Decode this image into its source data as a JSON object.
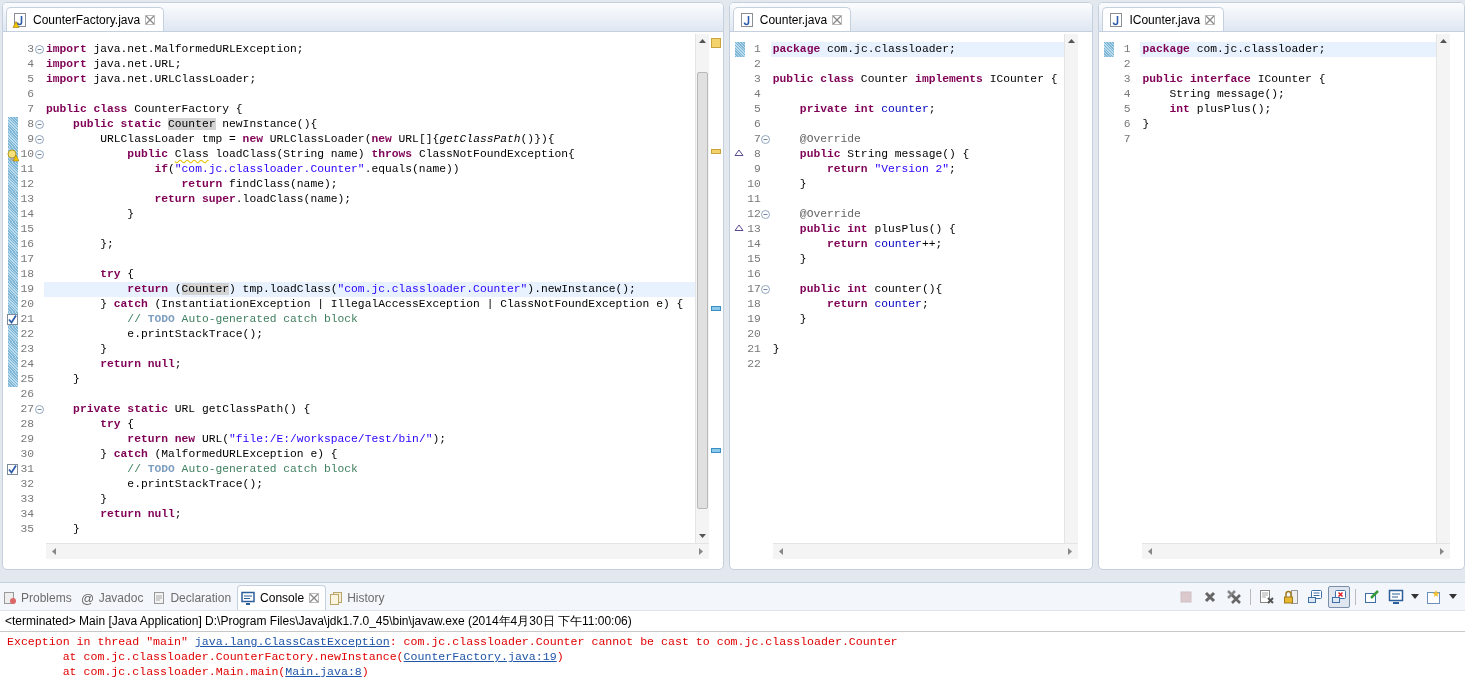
{
  "editors": [
    {
      "tab": {
        "label": "CounterFactory.java",
        "selected": true,
        "warning": true
      },
      "lines": [
        {
          "number": "3",
          "kind": "plain",
          "changed": false,
          "folding": true,
          "current": false,
          "tokens": [
            {
              "kind": "kw",
              "text": "import"
            },
            {
              "kind": "plain",
              "text": " java.net.MalformedURLException;"
            }
          ]
        },
        {
          "number": "4",
          "kind": "plain",
          "changed": false,
          "folding": false,
          "current": false,
          "tokens": [
            {
              "kind": "kw",
              "text": "import"
            },
            {
              "kind": "plain",
              "text": " java.net.URL;"
            }
          ]
        },
        {
          "number": "5",
          "kind": "plain",
          "changed": false,
          "folding": false,
          "current": false,
          "tokens": [
            {
              "kind": "kw",
              "text": "import"
            },
            {
              "kind": "plain",
              "text": " java.net.URLClassLoader;"
            }
          ]
        },
        {
          "number": "6",
          "kind": "plain",
          "changed": false,
          "folding": false,
          "current": false
        },
        {
          "number": "7",
          "kind": "plain",
          "changed": false,
          "folding": false,
          "current": false,
          "tokens": [
            {
              "kind": "kw",
              "text": "public class"
            },
            {
              "kind": "plain",
              "text": " CounterFactory {"
            }
          ]
        },
        {
          "number": "8",
          "kind": "plain",
          "changed": true,
          "folding": true,
          "current": false,
          "tokens": [
            {
              "kind": "kw",
              "text": "    public static "
            },
            {
              "kind": "occurrence",
              "text": "Counter"
            },
            {
              "kind": "plain",
              "text": " newInstance(){"
            }
          ]
        },
        {
          "number": "9",
          "kind": "plain",
          "changed": true,
          "folding": true,
          "current": false,
          "tokens": [
            {
              "kind": "plain",
              "text": "        URLClassLoader tmp = "
            },
            {
              "kind": "kw",
              "text": "new"
            },
            {
              "kind": "plain",
              "text": " URLClassLoader("
            },
            {
              "kind": "kw",
              "text": "new"
            },
            {
              "kind": "plain",
              "text": " URL[]{"
            },
            {
              "kind": "italic",
              "text": "getClassPath"
            },
            {
              "kind": "plain",
              "text": "()}){"
            }
          ]
        },
        {
          "number": "10",
          "kind": "warning",
          "changed": true,
          "folding": true,
          "current": false,
          "tokens": [
            {
              "kind": "kw",
              "text": "            public "
            },
            {
              "kind": "warn",
              "text": "Class"
            },
            {
              "kind": "plain",
              "text": " loadClass(String name) "
            },
            {
              "kind": "kw",
              "text": "throws"
            },
            {
              "kind": "plain",
              "text": " ClassNotFoundException{"
            }
          ]
        },
        {
          "number": "11",
          "kind": "plain",
          "changed": true,
          "folding": false,
          "current": false,
          "tokens": [
            {
              "kind": "kw",
              "text": "                if"
            },
            {
              "kind": "plain",
              "text": "("
            },
            {
              "kind": "string",
              "text": "\"com.jc.classloader.Counter\""
            },
            {
              "kind": "plain",
              "text": ".equals(name))"
            }
          ]
        },
        {
          "number": "12",
          "kind": "plain",
          "changed": true,
          "folding": false,
          "current": false,
          "tokens": [
            {
              "kind": "kw",
              "text": "                    return"
            },
            {
              "kind": "plain",
              "text": " findClass(name);"
            }
          ]
        },
        {
          "number": "13",
          "kind": "plain",
          "changed": true,
          "folding": false,
          "current": false,
          "tokens": [
            {
              "kind": "kw",
              "text": "                return super"
            },
            {
              "kind": "plain",
              "text": ".loadClass(name);"
            }
          ]
        },
        {
          "number": "14",
          "kind": "plain",
          "changed": true,
          "folding": false,
          "current": false,
          "tokens": [
            {
              "kind": "plain",
              "text": "            }"
            }
          ]
        },
        {
          "number": "15",
          "kind": "plain",
          "changed": true,
          "folding": false,
          "current": false
        },
        {
          "number": "16",
          "kind": "plain",
          "changed": true,
          "folding": false,
          "current": false,
          "tokens": [
            {
              "kind": "plain",
              "text": "        };"
            }
          ]
        },
        {
          "number": "17",
          "kind": "plain",
          "changed": true,
          "folding": false,
          "current": false
        },
        {
          "number": "18",
          "kind": "plain",
          "changed": true,
          "folding": false,
          "current": false,
          "tokens": [
            {
              "kind": "kw",
              "text": "        try"
            },
            {
              "kind": "plain",
              "text": " {"
            }
          ]
        },
        {
          "number": "19",
          "kind": "plain",
          "changed": true,
          "folding": false,
          "current": true,
          "tokens": [
            {
              "kind": "kw",
              "text": "            return"
            },
            {
              "kind": "plain",
              "text": " ("
            },
            {
              "kind": "occurrence",
              "text": "Counter"
            },
            {
              "kind": "plain",
              "text": ") tmp.loadClass("
            },
            {
              "kind": "string",
              "text": "\"com.jc.classloader.Counter\""
            },
            {
              "kind": "plain",
              "text": ").newInstance();"
            }
          ]
        },
        {
          "number": "20",
          "kind": "plain",
          "changed": true,
          "folding": false,
          "current": false,
          "tokens": [
            {
              "kind": "plain",
              "text": "        } "
            },
            {
              "kind": "kw",
              "text": "catch"
            },
            {
              "kind": "plain",
              "text": " (InstantiationException | IllegalAccessException | ClassNotFoundException e) {"
            }
          ]
        },
        {
          "number": "21",
          "kind": "task",
          "changed": true,
          "folding": false,
          "current": false,
          "tokens": [
            {
              "kind": "comment",
              "text": "            // "
            },
            {
              "kind": "todo",
              "text": "TODO"
            },
            {
              "kind": "comment",
              "text": " Auto-generated catch block"
            }
          ]
        },
        {
          "number": "22",
          "kind": "plain",
          "changed": true,
          "folding": false,
          "current": false,
          "tokens": [
            {
              "kind": "plain",
              "text": "            e.printStackTrace();"
            }
          ]
        },
        {
          "number": "23",
          "kind": "plain",
          "changed": true,
          "folding": false,
          "current": false,
          "tokens": [
            {
              "kind": "plain",
              "text": "        }"
            }
          ]
        },
        {
          "number": "24",
          "kind": "plain",
          "changed": true,
          "folding": false,
          "current": false,
          "tokens": [
            {
              "kind": "kw",
              "text": "        return null"
            },
            {
              "kind": "plain",
              "text": ";"
            }
          ]
        },
        {
          "number": "25",
          "kind": "plain",
          "changed": true,
          "folding": false,
          "current": false,
          "tokens": [
            {
              "kind": "plain",
              "text": "    }"
            }
          ]
        },
        {
          "number": "26",
          "kind": "plain",
          "changed": false,
          "folding": false,
          "current": false
        },
        {
          "number": "27",
          "kind": "plain",
          "changed": false,
          "folding": true,
          "current": false,
          "tokens": [
            {
              "kind": "kw",
              "text": "    private static"
            },
            {
              "kind": "plain",
              "text": " URL getClassPath() {"
            }
          ]
        },
        {
          "number": "28",
          "kind": "plain",
          "changed": false,
          "folding": false,
          "current": false,
          "tokens": [
            {
              "kind": "kw",
              "text": "        try"
            },
            {
              "kind": "plain",
              "text": " {"
            }
          ]
        },
        {
          "number": "29",
          "kind": "plain",
          "changed": false,
          "folding": false,
          "current": false,
          "tokens": [
            {
              "kind": "kw",
              "text": "            return new"
            },
            {
              "kind": "plain",
              "text": " URL("
            },
            {
              "kind": "string",
              "text": "\"file:/E:/workspace/Test/bin/\""
            },
            {
              "kind": "plain",
              "text": ");"
            }
          ]
        },
        {
          "number": "30",
          "kind": "plain",
          "changed": false,
          "folding": false,
          "current": false,
          "tokens": [
            {
              "kind": "plain",
              "text": "        } "
            },
            {
              "kind": "kw",
              "text": "catch"
            },
            {
              "kind": "plain",
              "text": " (MalformedURLException e) {"
            }
          ]
        },
        {
          "number": "31",
          "kind": "task",
          "changed": false,
          "folding": false,
          "current": false,
          "tokens": [
            {
              "kind": "comment",
              "text": "            // "
            },
            {
              "kind": "todo",
              "text": "TODO"
            },
            {
              "kind": "comment",
              "text": " Auto-generated catch block"
            }
          ]
        },
        {
          "number": "32",
          "kind": "plain",
          "changed": false,
          "folding": false,
          "current": false,
          "tokens": [
            {
              "kind": "plain",
              "text": "            e.printStackTrace();"
            }
          ]
        },
        {
          "number": "33",
          "kind": "plain",
          "changed": false,
          "folding": false,
          "current": false,
          "tokens": [
            {
              "kind": "plain",
              "text": "        }"
            }
          ]
        },
        {
          "number": "34",
          "kind": "plain",
          "changed": false,
          "folding": false,
          "current": false,
          "tokens": [
            {
              "kind": "kw",
              "text": "        return null"
            },
            {
              "kind": "plain",
              "text": ";"
            }
          ]
        },
        {
          "number": "35",
          "kind": "plain",
          "changed": false,
          "folding": false,
          "current": false,
          "tokens": [
            {
              "kind": "plain",
              "text": "    }"
            }
          ]
        }
      ]
    },
    {
      "tab": {
        "label": "Counter.java",
        "selected": true,
        "warning": false
      },
      "lines": [
        {
          "number": "1",
          "kind": "plain",
          "changed": true,
          "folding": false,
          "current": true,
          "tokens": [
            {
              "kind": "kw",
              "text": "package"
            },
            {
              "kind": "plain",
              "text": " com.jc.classloader;"
            }
          ]
        },
        {
          "number": "2",
          "kind": "plain",
          "changed": false,
          "folding": false,
          "current": false
        },
        {
          "number": "3",
          "kind": "plain",
          "changed": false,
          "folding": false,
          "current": false,
          "tokens": [
            {
              "kind": "kw",
              "text": "public class"
            },
            {
              "kind": "plain",
              "text": " Counter "
            },
            {
              "kind": "kw",
              "text": "implements"
            },
            {
              "kind": "plain",
              "text": " ICounter {"
            }
          ]
        },
        {
          "number": "4",
          "kind": "plain",
          "changed": false,
          "folding": false,
          "current": false
        },
        {
          "number": "5",
          "kind": "plain",
          "changed": false,
          "folding": false,
          "current": false,
          "tokens": [
            {
              "kind": "kw",
              "text": "    private int "
            },
            {
              "kind": "field",
              "text": "counter"
            },
            {
              "kind": "plain",
              "text": ";"
            }
          ]
        },
        {
          "number": "6",
          "kind": "plain",
          "changed": false,
          "folding": false,
          "current": false
        },
        {
          "number": "7",
          "kind": "plain",
          "changed": false,
          "folding": true,
          "current": false,
          "tokens": [
            {
              "kind": "annotation",
              "text": "    @Override"
            }
          ]
        },
        {
          "number": "8",
          "kind": "override",
          "changed": false,
          "folding": false,
          "current": false,
          "tokens": [
            {
              "kind": "kw",
              "text": "    public"
            },
            {
              "kind": "plain",
              "text": " String message() {"
            }
          ]
        },
        {
          "number": "9",
          "kind": "plain",
          "changed": false,
          "folding": false,
          "current": false,
          "tokens": [
            {
              "kind": "kw",
              "text": "        return "
            },
            {
              "kind": "string",
              "text": "\"Version 2\""
            },
            {
              "kind": "plain",
              "text": ";"
            }
          ]
        },
        {
          "number": "10",
          "kind": "plain",
          "changed": false,
          "folding": false,
          "current": false,
          "tokens": [
            {
              "kind": "plain",
              "text": "    }"
            }
          ]
        },
        {
          "number": "11",
          "kind": "plain",
          "changed": false,
          "folding": false,
          "current": false
        },
        {
          "number": "12",
          "kind": "plain",
          "changed": false,
          "folding": true,
          "current": false,
          "tokens": [
            {
              "kind": "annotation",
              "text": "    @Override"
            }
          ]
        },
        {
          "number": "13",
          "kind": "override",
          "changed": false,
          "folding": false,
          "current": false,
          "tokens": [
            {
              "kind": "kw",
              "text": "    public int"
            },
            {
              "kind": "plain",
              "text": " plusPlus() {"
            }
          ]
        },
        {
          "number": "14",
          "kind": "plain",
          "changed": false,
          "folding": false,
          "current": false,
          "tokens": [
            {
              "kind": "kw",
              "text": "        return "
            },
            {
              "kind": "field",
              "text": "counter"
            },
            {
              "kind": "plain",
              "text": "++;"
            }
          ]
        },
        {
          "number": "15",
          "kind": "plain",
          "changed": false,
          "folding": false,
          "current": false,
          "tokens": [
            {
              "kind": "plain",
              "text": "    }"
            }
          ]
        },
        {
          "number": "16",
          "kind": "plain",
          "changed": false,
          "folding": false,
          "current": false
        },
        {
          "number": "17",
          "kind": "plain",
          "changed": false,
          "folding": true,
          "current": false,
          "tokens": [
            {
              "kind": "kw",
              "text": "    public int"
            },
            {
              "kind": "plain",
              "text": " counter(){"
            }
          ]
        },
        {
          "number": "18",
          "kind": "plain",
          "changed": false,
          "folding": false,
          "current": false,
          "tokens": [
            {
              "kind": "kw",
              "text": "        return "
            },
            {
              "kind": "field",
              "text": "counter"
            },
            {
              "kind": "plain",
              "text": ";"
            }
          ]
        },
        {
          "number": "19",
          "kind": "plain",
          "changed": false,
          "folding": false,
          "current": false,
          "tokens": [
            {
              "kind": "plain",
              "text": "    }"
            }
          ]
        },
        {
          "number": "20",
          "kind": "plain",
          "changed": false,
          "folding": false,
          "current": false
        },
        {
          "number": "21",
          "kind": "plain",
          "changed": false,
          "folding": false,
          "current": false,
          "tokens": [
            {
              "kind": "plain",
              "text": "}"
            }
          ]
        },
        {
          "number": "22",
          "kind": "plain",
          "changed": false,
          "folding": false,
          "current": false
        }
      ]
    },
    {
      "tab": {
        "label": "ICounter.java",
        "selected": true,
        "warning": false
      },
      "lines": [
        {
          "number": "1",
          "kind": "plain",
          "changed": true,
          "folding": false,
          "current": true,
          "tokens": [
            {
              "kind": "kw",
              "text": "package"
            },
            {
              "kind": "plain",
              "text": " com.jc.classloader;"
            }
          ]
        },
        {
          "number": "2",
          "kind": "plain",
          "changed": false,
          "folding": false,
          "current": false
        },
        {
          "number": "3",
          "kind": "plain",
          "changed": false,
          "folding": false,
          "current": false,
          "tokens": [
            {
              "kind": "kw",
              "text": "public interface"
            },
            {
              "kind": "plain",
              "text": " ICounter {"
            }
          ]
        },
        {
          "number": "4",
          "kind": "plain",
          "changed": false,
          "folding": false,
          "current": false,
          "tokens": [
            {
              "kind": "plain",
              "text": "    String message();"
            }
          ]
        },
        {
          "number": "5",
          "kind": "plain",
          "changed": false,
          "folding": false,
          "current": false,
          "tokens": [
            {
              "kind": "kw",
              "text": "    int"
            },
            {
              "kind": "plain",
              "text": " plusPlus();"
            }
          ]
        },
        {
          "number": "6",
          "kind": "plain",
          "changed": false,
          "folding": false,
          "current": false,
          "tokens": [
            {
              "kind": "plain",
              "text": "}"
            }
          ]
        },
        {
          "number": "7",
          "kind": "plain",
          "changed": false,
          "folding": false,
          "current": false
        }
      ]
    }
  ],
  "console": {
    "tabs": [
      {
        "label": "Problems",
        "kind": "problems",
        "selected": false
      },
      {
        "label": "Javadoc",
        "kind": "javadoc",
        "glyph": "@",
        "selected": false
      },
      {
        "label": "Declaration",
        "kind": "declaration",
        "selected": false
      },
      {
        "label": "Console",
        "kind": "console",
        "selected": true
      },
      {
        "label": "History",
        "kind": "history",
        "selected": false
      }
    ],
    "toolbar": [
      [
        {
          "kind": "stop",
          "disabled": true,
          "selected": false
        },
        {
          "kind": "remove",
          "disabled": false,
          "selected": false
        },
        {
          "kind": "remove-all",
          "disabled": false,
          "selected": false
        }
      ],
      [
        {
          "kind": "clear",
          "disabled": false,
          "selected": false
        },
        {
          "kind": "scroll-lock",
          "disabled": false,
          "selected": false
        },
        {
          "kind": "stdout",
          "disabled": false,
          "selected": false
        },
        {
          "kind": "stderr",
          "disabled": false,
          "selected": true
        }
      ],
      [
        {
          "kind": "pin",
          "disabled": false,
          "selected": false
        },
        {
          "kind": "display",
          "disabled": false,
          "selected": false
        },
        {
          "kind": "caret",
          "disabled": false,
          "selected": false
        },
        {
          "kind": "new-console",
          "disabled": false,
          "selected": false
        },
        {
          "kind": "caret",
          "disabled": false,
          "selected": false
        }
      ]
    ],
    "status": "<terminated> Main [Java Application] D:\\Program Files\\Java\\jdk1.7.0_45\\bin\\javaw.exe (2014年4月30日 下午11:00:06)",
    "output": [
      {
        "segments": [
          {
            "kind": "text",
            "text": "Exception in thread \"main\" "
          },
          {
            "kind": "link",
            "text": "java.lang.ClassCastException"
          },
          {
            "kind": "text",
            "text": ": com.jc.classloader.Counter cannot be cast to com.jc.classloader.Counter"
          }
        ]
      },
      {
        "segments": [
          {
            "kind": "text",
            "text": "        at com.jc.classloader.CounterFactory.newInstance("
          },
          {
            "kind": "link",
            "text": "CounterFactory.java:19"
          },
          {
            "kind": "text",
            "text": ")"
          }
        ]
      },
      {
        "segments": [
          {
            "kind": "text",
            "text": "        at com.jc.classloader.Main.main("
          },
          {
            "kind": "link",
            "text": "Main.java:8"
          },
          {
            "kind": "text",
            "text": ")"
          }
        ]
      }
    ]
  }
}
